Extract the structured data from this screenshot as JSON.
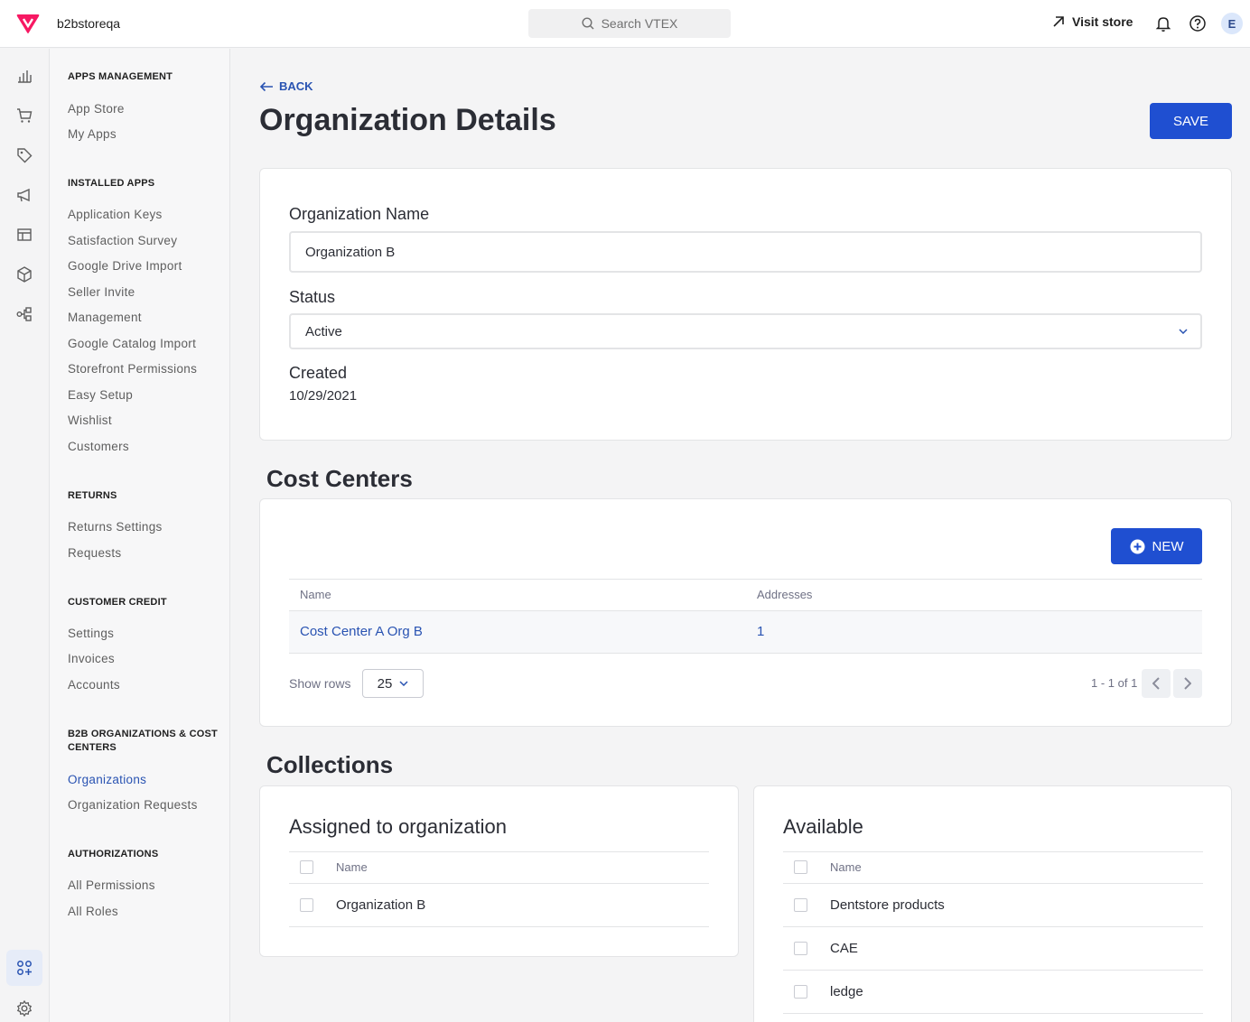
{
  "topbar": {
    "account": "b2bstoreqa",
    "search_placeholder": "Search VTEX",
    "visit_store": "Visit store",
    "avatar_initial": "E"
  },
  "sidebar": {
    "sections": [
      {
        "title": "APPS MANAGEMENT",
        "items": [
          "App Store",
          "My Apps"
        ]
      },
      {
        "title": "INSTALLED APPS",
        "items": [
          "Application Keys",
          "Satisfaction Survey",
          "Google Drive Import",
          "Seller Invite",
          "Management",
          "Google Catalog Import",
          "Storefront Permissions",
          "Easy Setup",
          "Wishlist",
          "Customers"
        ]
      },
      {
        "title": "RETURNS",
        "items": [
          "Returns Settings",
          "Requests"
        ]
      },
      {
        "title": "CUSTOMER CREDIT",
        "items": [
          "Settings",
          "Invoices",
          "Accounts"
        ]
      },
      {
        "title": "B2B ORGANIZATIONS & COST CENTERS",
        "items": [
          "Organizations",
          "Organization Requests"
        ]
      },
      {
        "title": "AUTHORIZATIONS",
        "items": [
          "All Permissions",
          "All Roles"
        ]
      }
    ]
  },
  "page": {
    "back": "BACK",
    "title": "Organization Details",
    "save": "SAVE"
  },
  "details": {
    "name_label": "Organization Name",
    "name_value": "Organization B",
    "status_label": "Status",
    "status_value": "Active",
    "created_label": "Created",
    "created_value": "10/29/2021"
  },
  "cost_centers": {
    "heading": "Cost Centers",
    "new_button": "NEW",
    "columns": [
      "Name",
      "Addresses"
    ],
    "rows": [
      {
        "name": "Cost Center A Org B",
        "addresses": "1"
      }
    ],
    "show_rows_label": "Show rows",
    "rows_per_page": "25",
    "pagination": "1 - 1 of 1"
  },
  "collections": {
    "heading": "Collections",
    "assigned": {
      "title": "Assigned to organization",
      "column": "Name",
      "rows": [
        "Organization B"
      ]
    },
    "available": {
      "title": "Available",
      "column": "Name",
      "rows": [
        "Dentstore products",
        "CAE",
        "ledge"
      ]
    }
  },
  "colors": {
    "primary": "#1f4fd1",
    "link": "#2953b2",
    "brand": "#f71963"
  }
}
